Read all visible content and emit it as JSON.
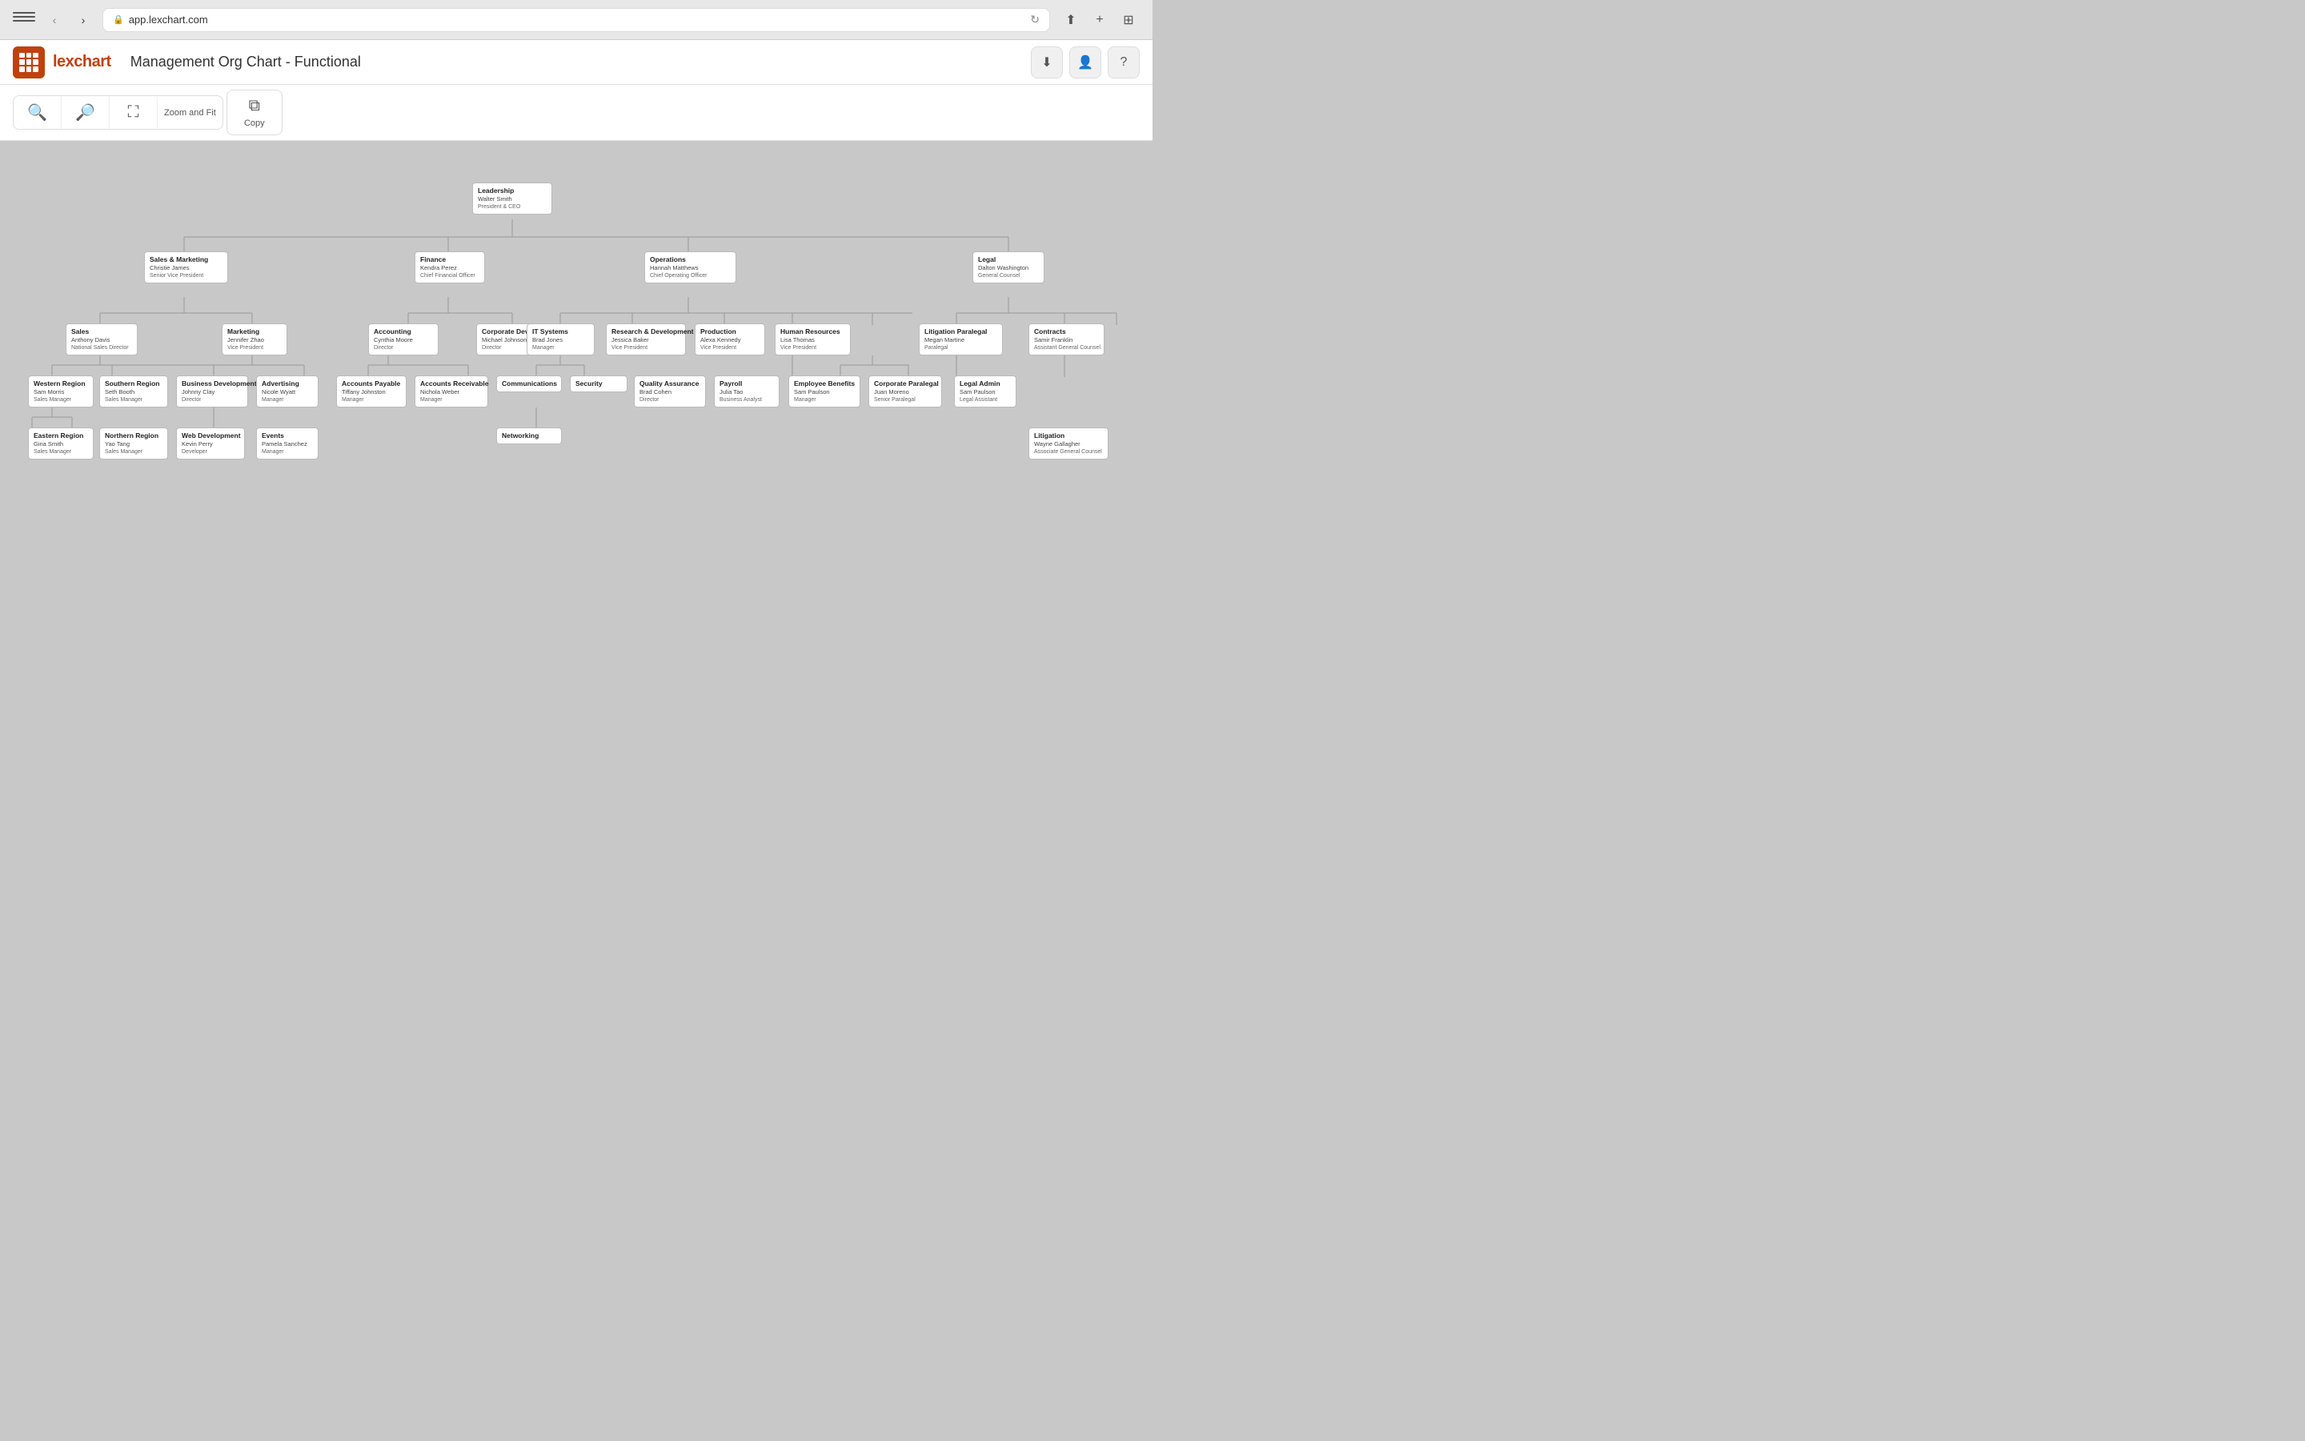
{
  "browser": {
    "url": "app.lexchart.com",
    "back_enabled": false,
    "forward_enabled": true
  },
  "app": {
    "logo_text": "lexchart",
    "title": "Management Org Chart - Functional"
  },
  "toolbar": {
    "zoom_fit_label": "Zoom and Fit",
    "copy_label": "Copy"
  },
  "nodes": {
    "leadership": {
      "dept": "Leadership",
      "name": "Walter Smith",
      "title": "President & CEO"
    },
    "sales_marketing": {
      "dept": "Sales & Marketing",
      "name": "Christie James",
      "title": "Senior Vice President"
    },
    "finance": {
      "dept": "Finance",
      "name": "Kendra Perez",
      "title": "Chief Financial Officer"
    },
    "operations": {
      "dept": "Operations",
      "name": "Hannah Matthews",
      "title": "Chief Operating Officer"
    },
    "legal": {
      "dept": "Legal",
      "name": "Dalton Washington",
      "title": "General Counsel"
    },
    "sales": {
      "dept": "Sales",
      "name": "Anthony Davis",
      "title": "National Sales Director"
    },
    "marketing": {
      "dept": "Marketing",
      "name": "Jennifer Zhao",
      "title": "Vice President"
    },
    "accounting": {
      "dept": "Accounting",
      "name": "Cynthia Moore",
      "title": "Director"
    },
    "corporate_dev": {
      "dept": "Corporate Development",
      "name": "Michael Johnson",
      "title": "Director"
    },
    "it_systems": {
      "dept": "IT Systems",
      "name": "Brad Jones",
      "title": "Manager"
    },
    "research_dev": {
      "dept": "Research & Development",
      "name": "Jessica Baker",
      "title": "Vice President"
    },
    "production": {
      "dept": "Production",
      "name": "Alexa Kennedy",
      "title": "Vice President"
    },
    "human_resources": {
      "dept": "Human Resources",
      "name": "Lisa Thomas",
      "title": "Vice President"
    },
    "litigation_paralegal": {
      "dept": "Litigation Paralegal",
      "name": "Megan Martine",
      "title": "Paralegal"
    },
    "contracts": {
      "dept": "Contracts",
      "name": "Samir Franklin",
      "title": "Assistant General Counsel"
    },
    "western_region": {
      "dept": "Western Region",
      "name": "Sam Morris",
      "title": "Sales Manager"
    },
    "southern_region": {
      "dept": "Southern Region",
      "name": "Seth Booth",
      "title": "Sales Manager"
    },
    "business_dev": {
      "dept": "Business Development",
      "name": "Johnny Clay",
      "title": "Director"
    },
    "advertising": {
      "dept": "Advertising",
      "name": "Nicole Wyatt",
      "title": "Manager"
    },
    "accounts_payable": {
      "dept": "Accounts Payable",
      "name": "Tiffany Johnston",
      "title": "Manager"
    },
    "accounts_receivable": {
      "dept": "Accounts Receivable",
      "name": "Nichola Weber",
      "title": "Manager"
    },
    "communications": {
      "dept": "Communications",
      "name": "",
      "title": ""
    },
    "security": {
      "dept": "Security",
      "name": "",
      "title": ""
    },
    "quality_assurance": {
      "dept": "Quality Assurance",
      "name": "Brad Cohen",
      "title": "Director"
    },
    "payroll": {
      "dept": "Payroll",
      "name": "Julia Tao",
      "title": "Business Analyst"
    },
    "employee_benefits": {
      "dept": "Employee Benefits",
      "name": "Sam Paulson",
      "title": "Manager"
    },
    "corporate_paralegal": {
      "dept": "Corporate Paralegal",
      "name": "Juan Moreno",
      "title": "Senior Paralegal"
    },
    "legal_admin": {
      "dept": "Legal Admin",
      "name": "Sam Paulson",
      "title": "Legal Assistant"
    },
    "eastern_region": {
      "dept": "Eastern Region",
      "name": "Gina Smith",
      "title": "Sales Manager"
    },
    "northern_region": {
      "dept": "Northern Region",
      "name": "Yao Tang",
      "title": "Sales Manager"
    },
    "web_development": {
      "dept": "Web Development",
      "name": "Kevin Perry",
      "title": "Developer"
    },
    "events": {
      "dept": "Events",
      "name": "Pamela Sanchez",
      "title": "Manager"
    },
    "networking": {
      "dept": "Networking",
      "name": "",
      "title": ""
    },
    "litigation": {
      "dept": "Litigation",
      "name": "Wayne Gallagher",
      "title": "Associate General Counsel"
    }
  }
}
